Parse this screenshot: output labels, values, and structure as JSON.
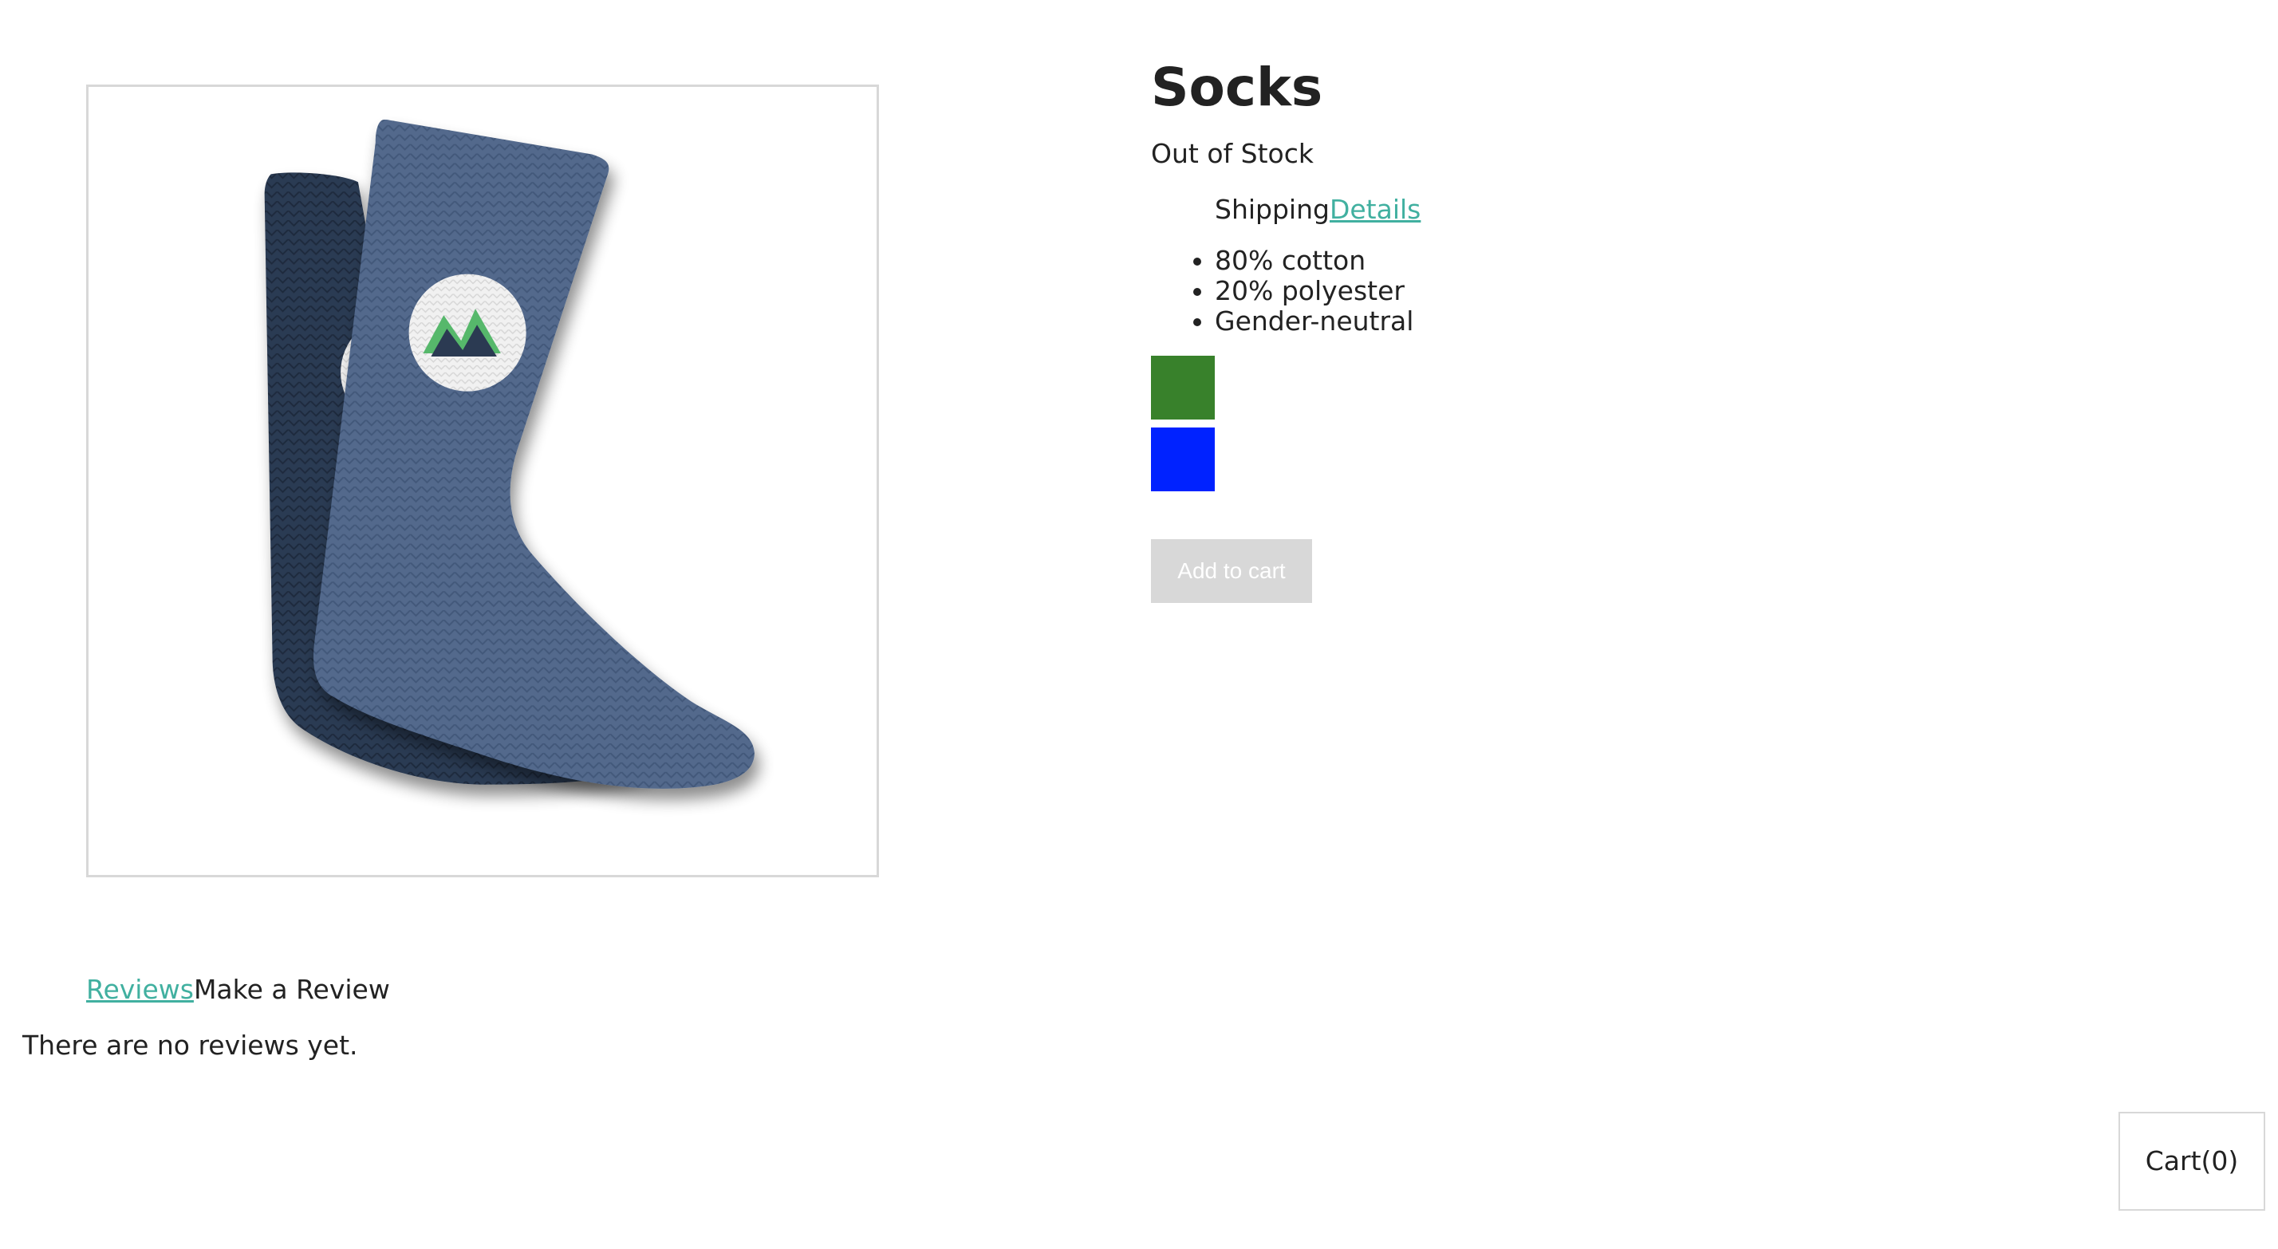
{
  "product": {
    "title": "Socks",
    "stock_status": "Out of Stock",
    "shipping_label": "Shipping",
    "details_link": "Details",
    "details": [
      "80% cotton",
      "20% polyester",
      "Gender-neutral"
    ],
    "variants": [
      {
        "color": "#38812b",
        "name": "green"
      },
      {
        "color": "#0022ff",
        "name": "blue"
      }
    ],
    "add_to_cart_label": "Add to cart",
    "add_to_cart_disabled": true
  },
  "reviews": {
    "tab_reviews": "Reviews",
    "tab_make_review": "Make a Review",
    "empty_message": "There are no reviews yet."
  },
  "cart": {
    "label": "Cart(0)"
  },
  "colors": {
    "link": "#41b0a0",
    "disabled_button": "#d8d8d8",
    "text": "#222222"
  }
}
